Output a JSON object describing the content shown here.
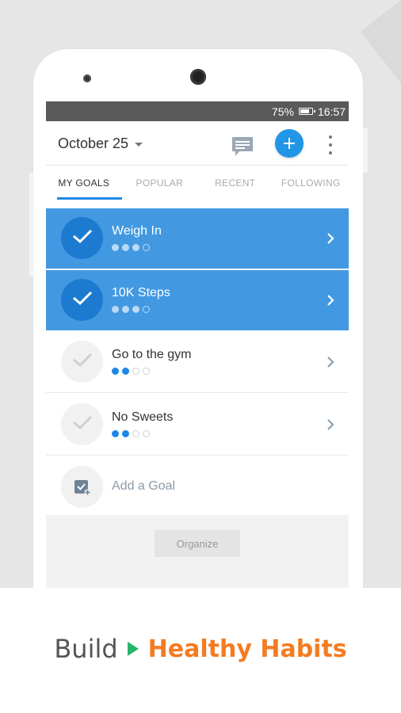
{
  "status": {
    "battery": "75%",
    "time": "16:57"
  },
  "appbar": {
    "date": "October 25"
  },
  "tabs": [
    "MY GOALS",
    "POPULAR",
    "RECENT",
    "FOLLOWING"
  ],
  "goals": [
    {
      "name": "Weigh In",
      "done": true,
      "progress": 3,
      "total": 4
    },
    {
      "name": "10K Steps",
      "done": true,
      "progress": 3,
      "total": 4
    },
    {
      "name": "Go to the gym",
      "done": false,
      "progress": 2,
      "total": 4
    },
    {
      "name": "No Sweets",
      "done": false,
      "progress": 2,
      "total": 4
    }
  ],
  "add_goal": {
    "label": "Add a Goal"
  },
  "organize": {
    "label": "Organize"
  },
  "tagline": {
    "prefix": "Build",
    "highlight": "Healthy Habits"
  },
  "colors": {
    "accent": "#2196e6",
    "done_row": "#4299e1",
    "brand_orange": "#f47b20",
    "play_green": "#27b36b"
  },
  "icons": [
    "message-icon",
    "plus-icon",
    "more-vert-icon",
    "check-icon",
    "chevron-right-icon",
    "add-goal-icon",
    "play-icon"
  ]
}
